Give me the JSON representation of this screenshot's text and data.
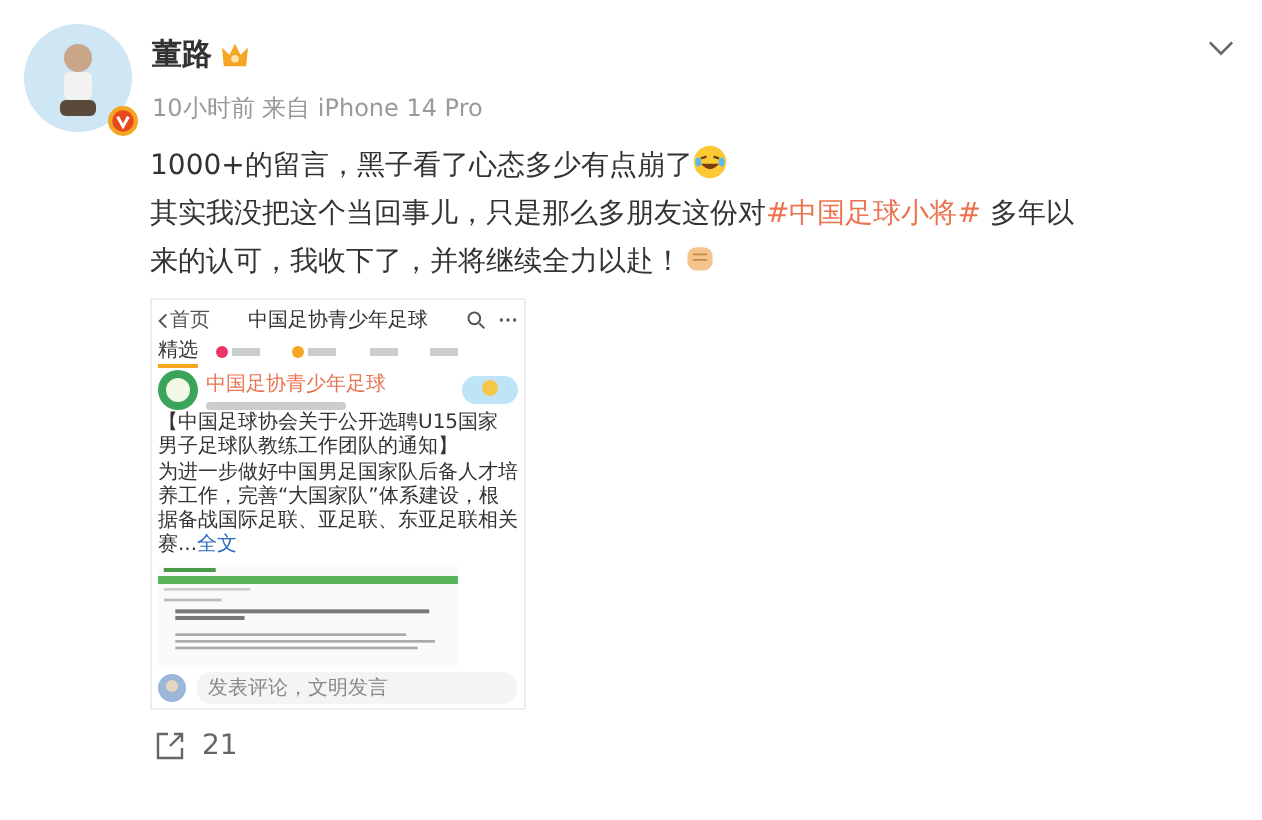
{
  "author": {
    "name": "董路",
    "meta": "10小时前 来自 iPhone 14 Pro"
  },
  "paragraphs": [
    [
      {
        "kind": "text",
        "text": "1000+的留言，黑子看了心态多少有点崩了"
      },
      {
        "kind": "laugh"
      }
    ],
    [
      {
        "kind": "text",
        "text": "其实我没把这个当回事儿，只是那么多朋友这份对"
      },
      {
        "kind": "hashtag",
        "text": "#中国足球小将#"
      },
      {
        "kind": "text",
        "text": " 多年以来的认可，我收下了，并将继续全力以赴！"
      },
      {
        "kind": "fist"
      }
    ]
  ],
  "embedded": {
    "back": "首页",
    "title": "中国足协青少年足球",
    "tabs": [
      {
        "label": "精选",
        "selected": true
      }
    ],
    "account": "中国足协青少年足球",
    "headline": "【中国足球协会关于公开选聘U15国家男子足球队教练工作团队的通知】",
    "body": "为进一步做好中国男足国家队后备人才培养工作，完善“大国家队”体系建设，根据备战国际足联、亚足联、东亚足联相关赛...",
    "more": "全文",
    "comment_placeholder": "发表评论，文明发言"
  },
  "share_count": "21"
}
